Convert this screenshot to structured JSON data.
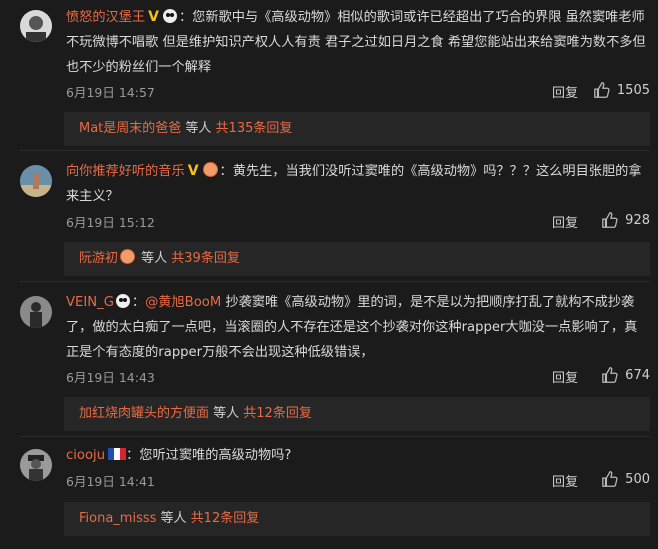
{
  "reply_label": "回复",
  "like_icon": "thumbs-up-icon",
  "comments": [
    {
      "username": "愤怒的汉堡王",
      "text": "您新歌中与《高级动物》相似的歌词或许已经超出了巧合的界限 虽然窦唯老师不玩微博不唱歌 但是维护知识产权人人有责 君子之过如日月之食 希望您能站出来给窦唯为数不多但也不少的粉丝们一个解释",
      "time": "6月19日 14:57",
      "likes": "1505",
      "sub_user": "Mat是周末的爸爸",
      "sub_mid": " 等人 ",
      "sub_count": "共135条回复"
    },
    {
      "username": "向你推荐好听的音乐",
      "text": "黄先生，当我们没听过窦唯的《高级动物》吗？？？这么明目张胆的拿来主义？",
      "time": "6月19日 15:12",
      "likes": "928",
      "sub_user": "阮游初",
      "sub_mid": " 等人 ",
      "sub_count": "共39条回复"
    },
    {
      "username": "VEIN_G",
      "mention": "@黄旭BooM",
      "text": " 抄袭窦唯《高级动物》里的词，是不是以为把顺序打乱了就构不成抄袭了，做的太白痴了一点吧，当滚圈的人不存在还是这个抄袭对你这种rapper大咖没一点影响了，真正是个有态度的rapper万般不会出现这种低级错误，",
      "time": "6月19日 14:43",
      "likes": "674",
      "sub_user": "加红烧肉罐头的方便面",
      "sub_mid": " 等人 ",
      "sub_count": "共12条回复"
    },
    {
      "username": "ciooju",
      "text": "您听过窦唯的高级动物吗?",
      "time": "6月19日 14:41",
      "likes": "500",
      "sub_user": "Fiona_misss",
      "sub_mid": " 等人 ",
      "sub_count": "共12条回复"
    }
  ]
}
